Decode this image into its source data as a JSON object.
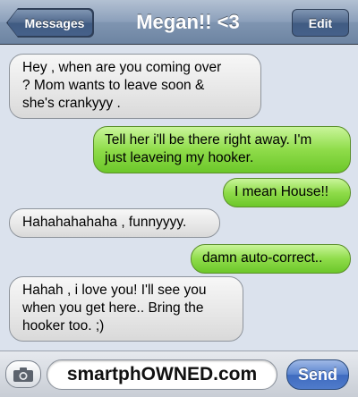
{
  "navbar": {
    "back_label": "Messages",
    "title": "Megan!! <3",
    "edit_label": "Edit"
  },
  "messages": [
    {
      "side": "in",
      "text": "Hey , when are you coming over\n? Mom wants to leave soon &\nshe's crankyyy ."
    },
    {
      "side": "out",
      "text": "Tell her i'll be there right away. I'm\njust leaveing my hooker."
    },
    {
      "side": "out",
      "text": "I mean House!!"
    },
    {
      "side": "in",
      "text": "Hahahahahaha , funnyyyy."
    },
    {
      "side": "out",
      "text": "damn auto-correct.."
    },
    {
      "side": "in",
      "text": "Hahah , i love you! I'll see you\nwhen you get here.. Bring the\nhooker too. ;)"
    }
  ],
  "compose": {
    "camera_icon": "camera-icon",
    "field_text": "smartphOWNED.com",
    "send_label": "Send"
  },
  "colors": {
    "incoming_bubble": "#e6e6e6",
    "outgoing_bubble": "#8fdc4a",
    "navbar": "#8b9fba",
    "send_button": "#5a84cf"
  }
}
